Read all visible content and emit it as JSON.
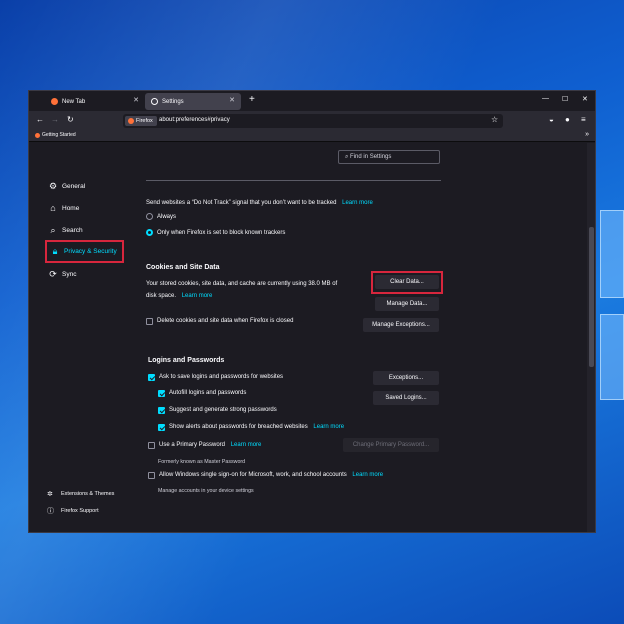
{
  "tabs": [
    {
      "label": "New Tab",
      "active": false
    },
    {
      "label": "Settings",
      "active": true
    }
  ],
  "toolbar": {
    "identity_label": "Firefox",
    "url": "about:preferences#privacy"
  },
  "bookmarks": [
    {
      "label": "Getting Started"
    }
  ],
  "search": {
    "placeholder": "Find in Settings"
  },
  "sidebar": {
    "items": [
      {
        "label": "General",
        "icon": "gear-icon"
      },
      {
        "label": "Home",
        "icon": "home-icon"
      },
      {
        "label": "Search",
        "icon": "search-icon"
      },
      {
        "label": "Privacy & Security",
        "icon": "lock-icon",
        "selected": true
      },
      {
        "label": "Sync",
        "icon": "sync-icon"
      }
    ],
    "footer": [
      {
        "label": "Extensions & Themes",
        "icon": "puzzle-icon"
      },
      {
        "label": "Firefox Support",
        "icon": "help-icon"
      }
    ]
  },
  "dnt": {
    "text": "Send websites a “Do Not Track” signal that you don’t want to be tracked",
    "learn_more": "Learn more",
    "option_always": "Always",
    "option_only": "Only when Firefox is set to block known trackers"
  },
  "cookies": {
    "heading": "Cookies and Site Data",
    "desc_line1": "Your stored cookies, site data, and cache are currently using 38.0 MB of",
    "desc_line2": "disk space.",
    "learn_more": "Learn more",
    "clear_button": "Clear Data...",
    "manage_button": "Manage Data...",
    "delete_on_close": "Delete cookies and site data when Firefox is closed",
    "exceptions_button": "Manage Exceptions..."
  },
  "logins": {
    "heading": "Logins and Passwords",
    "ask_save": "Ask to save logins and passwords for websites",
    "autofill": "Autofill logins and passwords",
    "suggest": "Suggest and generate strong passwords",
    "alerts": "Show alerts about passwords for breached websites",
    "alerts_learn_more": "Learn more",
    "primary_password": "Use a Primary Password",
    "primary_learn_more": "Learn more",
    "formerly": "Formerly known as Master Password",
    "windows_sso": "Allow Windows single sign-on for Microsoft, work, and school accounts",
    "sso_learn_more": "Learn more",
    "sso_sub": "Manage accounts in your device settings",
    "exceptions_button": "Exceptions...",
    "saved_logins_button": "Saved Logins...",
    "change_primary_button": "Change Primary Password..."
  },
  "colors": {
    "accent": "#00ddff",
    "highlight": "#d7263d"
  }
}
